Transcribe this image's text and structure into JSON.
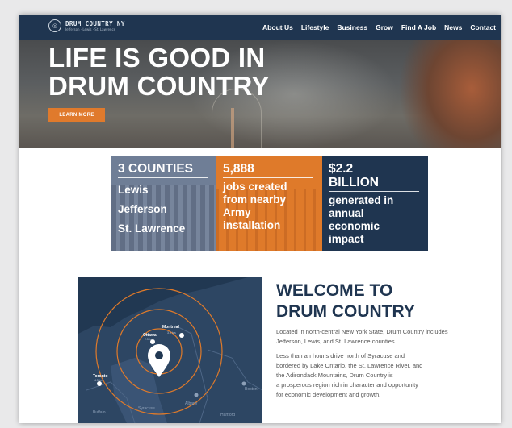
{
  "nav": {
    "logo_title": "DRUM COUNTRY NY",
    "logo_subtitle": "Jefferson · Lewis · St. Lawrence",
    "items": [
      "About Us",
      "Lifestyle",
      "Business",
      "Grow",
      "Find A Job",
      "News",
      "Contact"
    ]
  },
  "hero": {
    "headline_line1": "LIFE IS GOOD IN",
    "headline_line2": "DRUM COUNTRY",
    "button_label": "LEARN MORE"
  },
  "stats": [
    {
      "heading": "3 COUNTIES",
      "lines": [
        "Lewis",
        "Jefferson",
        "St. Lawrence"
      ],
      "color": "#6f7e96"
    },
    {
      "heading": "5,888",
      "lines": [
        "jobs created",
        "from nearby",
        "Army",
        "installation"
      ],
      "color": "#df7a2a"
    },
    {
      "heading_line1": "$2.2",
      "heading_line2": "BILLION",
      "lines": [
        "generated in",
        "annual",
        "economic",
        "impact"
      ],
      "color": "#1f3550"
    }
  ],
  "map": {
    "labels": [
      "Montreal",
      "Ottawa",
      "Toronto",
      "Buffalo",
      "Syracuse",
      "Albany",
      "Boston",
      "Hartford"
    ],
    "distances": [
      "3.5 hrs",
      "2.5 hrs",
      "4.5 hrs"
    ]
  },
  "welcome": {
    "title_line1": "WELCOME TO",
    "title_line2": "DRUM COUNTRY",
    "paragraph1": "Located in north-central New York State, Drum Country includes Jefferson, Lewis, and St. Lawrence counties.",
    "paragraph2_lines": [
      "Less than an hour's drive north of Syracuse and",
      "bordered by Lake Ontario, the St. Lawrence River, and",
      "the Adirondack Mountains, Drum Country is",
      "a prosperous region rich in character and opportunity",
      "for economic development and growth."
    ]
  },
  "colors": {
    "navy": "#1f3550",
    "orange": "#df7a2a",
    "slate": "#6f7e96"
  }
}
